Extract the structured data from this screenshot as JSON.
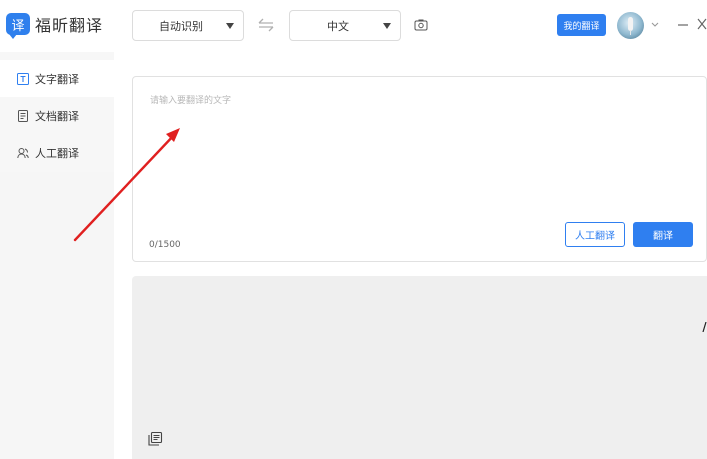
{
  "app": {
    "logo_glyph": "译",
    "logo_text": "福昕翻译"
  },
  "toolbar": {
    "source_language": "自动识别",
    "target_language": "中文",
    "my_translate_label": "我的翻译"
  },
  "sidebar": {
    "items": [
      {
        "label": "文字翻译",
        "icon": "text-icon",
        "active": true
      },
      {
        "label": "文档翻译",
        "icon": "document-icon",
        "active": false
      },
      {
        "label": "人工翻译",
        "icon": "human-translate-icon",
        "active": false
      }
    ]
  },
  "input": {
    "placeholder": "请输入要翻译的文字",
    "value": "",
    "char_count": "0/1500",
    "human_button_label": "人工翻译",
    "translate_button_label": "翻译"
  },
  "output": {
    "text": ""
  },
  "colors": {
    "accent": "#2f7ff0",
    "annotation_arrow": "#e02020",
    "sidebar_bg": "#f7f7f7",
    "output_bg": "#efefef"
  }
}
